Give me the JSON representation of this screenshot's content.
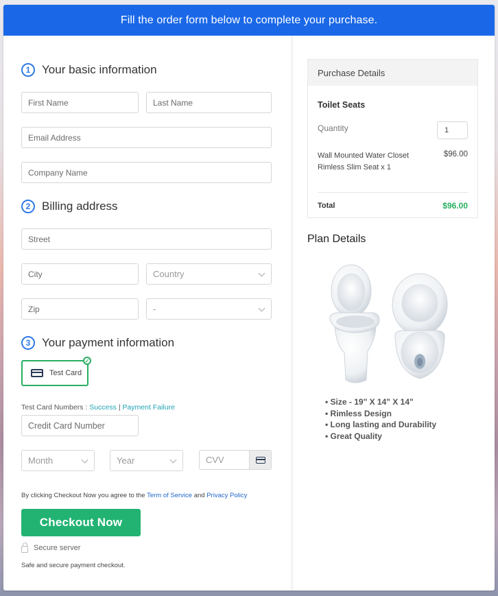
{
  "banner": {
    "text": "Fill the order form below to complete your purchase."
  },
  "sections": {
    "basic": {
      "number": "1",
      "title": "Your basic information"
    },
    "billing": {
      "number": "2",
      "title": "Billing address"
    },
    "payment": {
      "number": "3",
      "title": "Your payment information"
    }
  },
  "fields": {
    "first_name": {
      "placeholder": "First Name",
      "value": ""
    },
    "last_name": {
      "placeholder": "Last Name",
      "value": ""
    },
    "email": {
      "placeholder": "Email Address",
      "value": ""
    },
    "company": {
      "placeholder": "Company Name",
      "value": ""
    },
    "street": {
      "placeholder": "Street",
      "value": ""
    },
    "city": {
      "placeholder": "City",
      "value": ""
    },
    "country": {
      "selected": "Country"
    },
    "zip": {
      "placeholder": "Zip",
      "value": ""
    },
    "state": {
      "selected": "-"
    },
    "card_number": {
      "placeholder": "Credit Card Number",
      "value": ""
    },
    "month": {
      "selected": "Month"
    },
    "year": {
      "selected": "Year"
    },
    "cvv": {
      "placeholder": "CVV",
      "value": ""
    }
  },
  "payment": {
    "method_label": "Test Card",
    "test_numbers_label": "Test Card Numbers :",
    "success_link": "Success",
    "separator": "|",
    "failure_link": "Payment Failure"
  },
  "agreement": {
    "prefix": "By clicking Checkout Now you agree to the",
    "terms_link": "Term of Service",
    "and": "and",
    "privacy_link": "Privacy Policy"
  },
  "checkout_button": "Checkout Now",
  "secure_label": "Secure server",
  "safe_text": "Safe and secure payment checkout.",
  "purchase": {
    "header": "Purchase Details",
    "product": "Toilet Seats",
    "quantity_label": "Quantity",
    "quantity": "1",
    "item_name": "Wall Mounted Water Closet Rimless Slim Seat x 1",
    "item_price": "$96.00",
    "total_label": "Total",
    "total_value": "$96.00"
  },
  "plan": {
    "title": "Plan Details",
    "image_alt": "White toilet side view and top view",
    "features": [
      "Size - 19\" X 14\" X 14\"",
      "Rimless Design",
      "Long lasting and Durability",
      "Great Quality"
    ]
  },
  "colors": {
    "banner": "#1a68e8",
    "accent_green": "#22b373",
    "step_blue": "#2f7be6",
    "link_teal": "#1fa3b5"
  }
}
